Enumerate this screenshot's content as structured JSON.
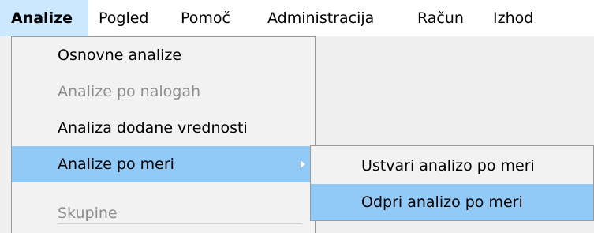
{
  "menubar": {
    "items": [
      {
        "label": "Analize"
      },
      {
        "label": "Pogled"
      },
      {
        "label": "Pomoč"
      },
      {
        "label": "Administracija"
      },
      {
        "label": "Račun"
      },
      {
        "label": "Izhod"
      }
    ]
  },
  "dropdown": {
    "items": [
      {
        "label": "Osnovne analize",
        "enabled": true
      },
      {
        "label": "Analize po nalogah",
        "enabled": false
      },
      {
        "label": "Analiza dodane vrednosti",
        "enabled": true
      },
      {
        "label": "Analize po meri",
        "enabled": true,
        "highlighted": true,
        "has_submenu": true
      },
      {
        "label": "Skupine",
        "enabled": false
      }
    ]
  },
  "submenu": {
    "items": [
      {
        "label": "Ustvari analizo po meri"
      },
      {
        "label": "Odpri analizo po meri",
        "highlighted": true
      }
    ]
  },
  "colors": {
    "highlight": "#91c9f7",
    "menubar_active": "#cce8ff",
    "disabled_text": "#8d8d8d"
  },
  "icons": [
    "chevron-right-icon"
  ]
}
